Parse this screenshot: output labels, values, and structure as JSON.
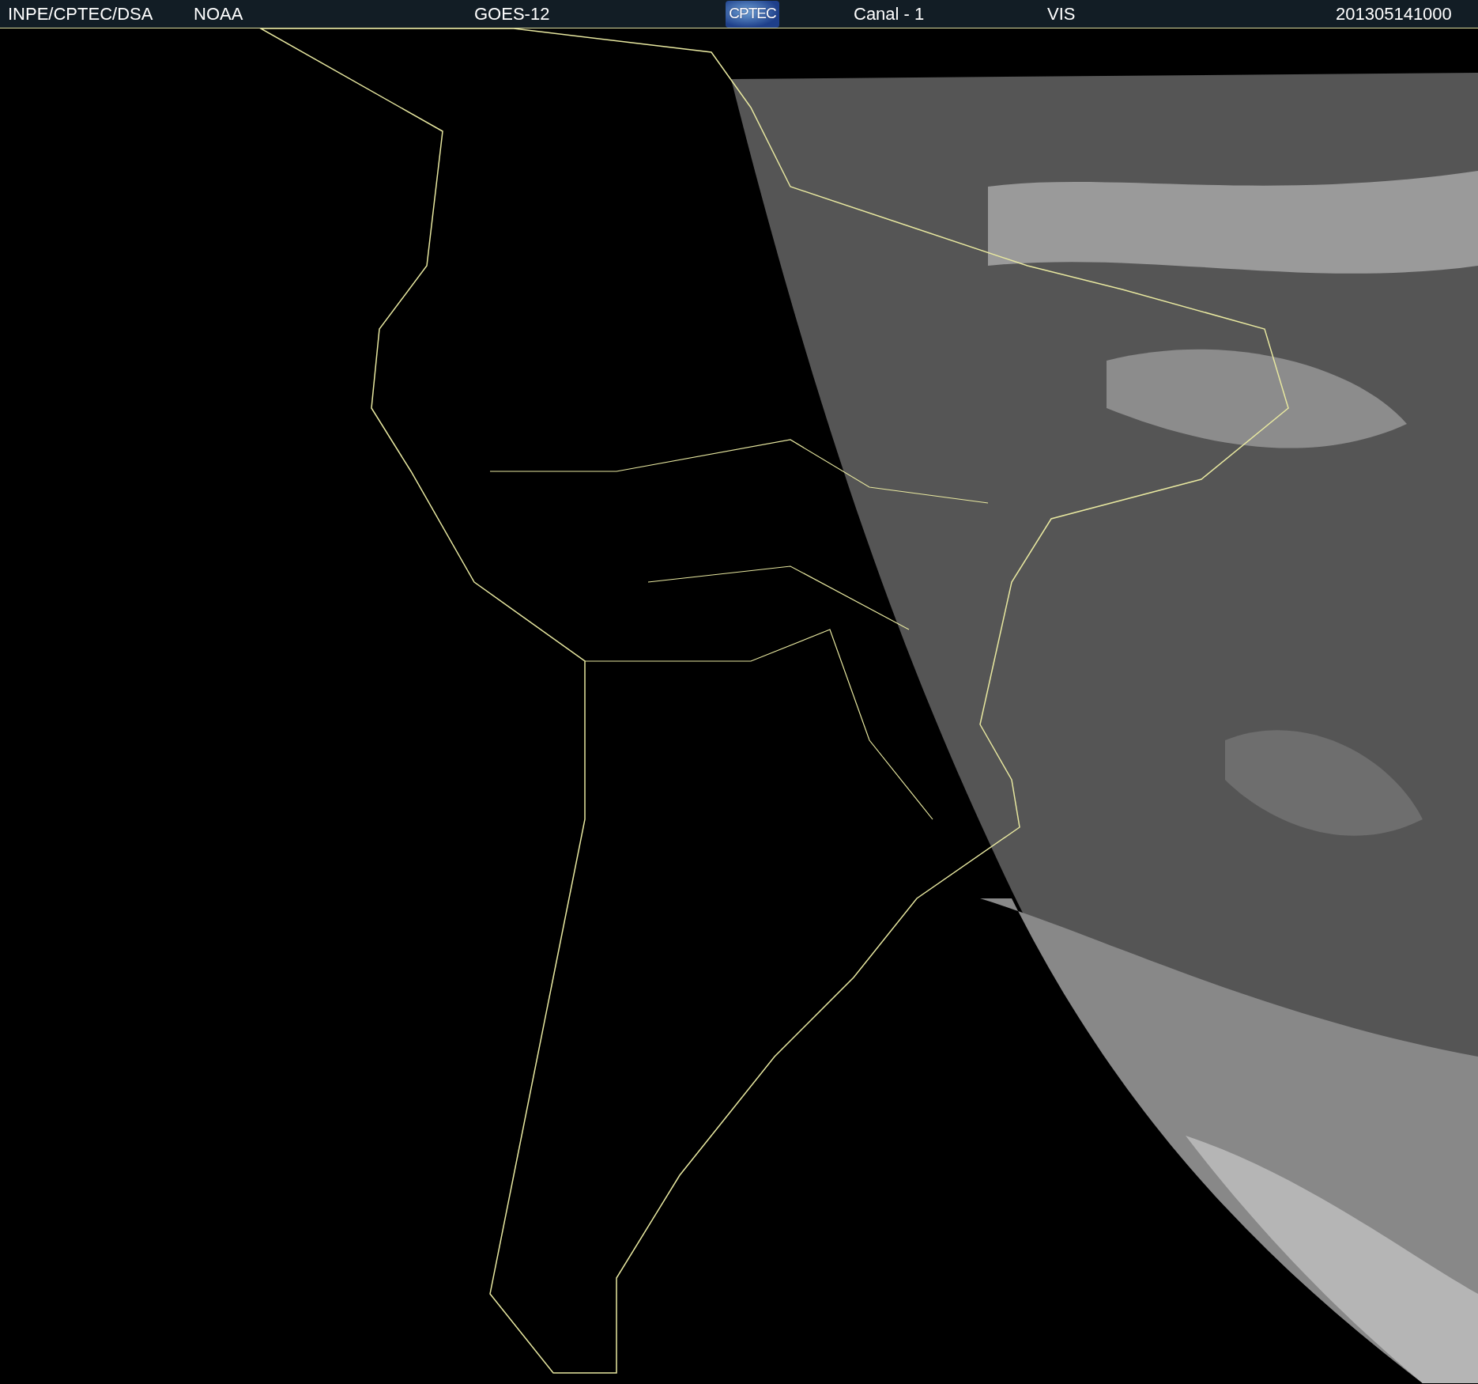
{
  "header": {
    "items": [
      {
        "kind": "text",
        "text": "INPE/CPTEC/DSA"
      },
      {
        "kind": "text",
        "text": "NOAA"
      },
      {
        "kind": "text",
        "text": "GOES-12"
      },
      {
        "kind": "logo",
        "text": "CPTEC"
      },
      {
        "kind": "text",
        "text": "Canal - 1"
      },
      {
        "kind": "text",
        "text": "VIS"
      },
      {
        "kind": "text",
        "text": "201305141000"
      }
    ]
  }
}
